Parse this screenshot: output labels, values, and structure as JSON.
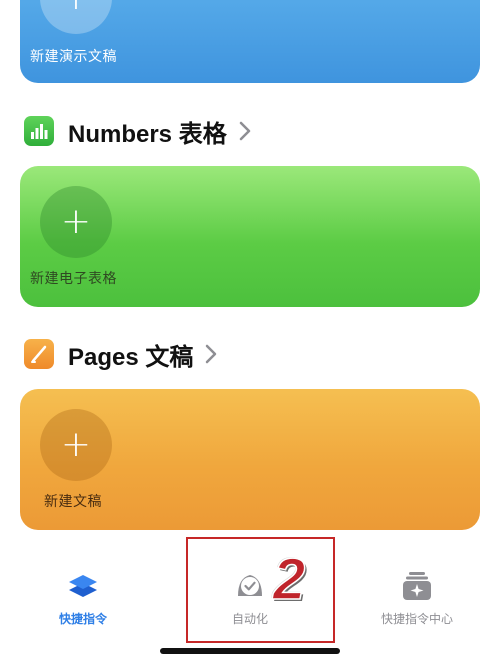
{
  "keynote_card": {
    "plus": "+",
    "label": "新建演示文稿"
  },
  "numbers_section": {
    "title": "Numbers 表格",
    "icon": "numbers-app-icon",
    "card": {
      "plus": "+",
      "label": "新建电子表格"
    }
  },
  "pages_section": {
    "title": "Pages 文稿",
    "icon": "pages-app-icon",
    "card": {
      "plus": "+",
      "label": "新建文稿"
    }
  },
  "tabbar": {
    "tabs": [
      {
        "label": "快捷指令",
        "icon": "layers-icon",
        "selected": true
      },
      {
        "label": "自动化",
        "icon": "clock-check-icon",
        "selected": false
      },
      {
        "label": "快捷指令中心",
        "icon": "gallery-sparkle-icon",
        "selected": false
      }
    ]
  },
  "annotation": {
    "number": "2",
    "color": "#c62828"
  },
  "colors": {
    "accent": "#2f7fe6",
    "numbers_green": "#5ccc45",
    "pages_orange": "#f0a73d",
    "keynote_blue": "#4a9fe5"
  }
}
